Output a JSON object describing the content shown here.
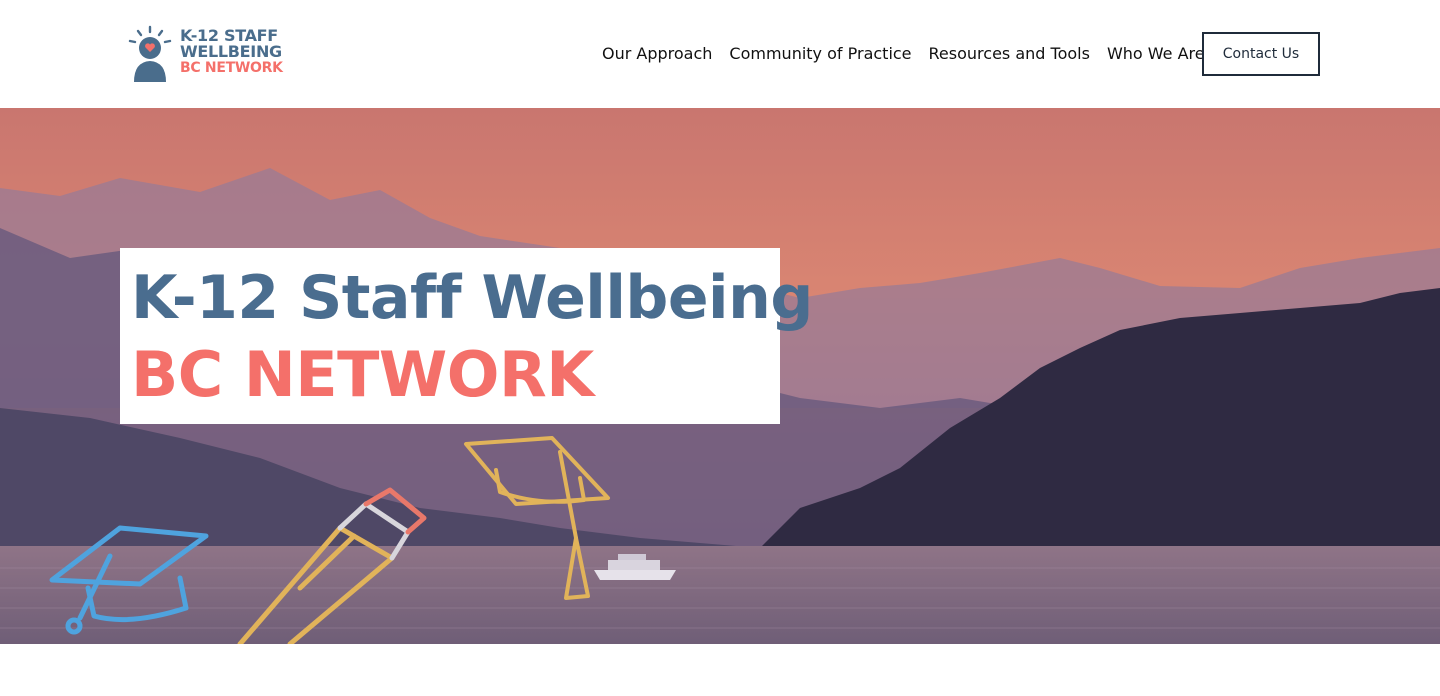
{
  "logo": {
    "line1": "K-12 STAFF",
    "line2": "WELLBEING",
    "line3": "BC NETWORK",
    "icon": "person-heart-icon"
  },
  "nav": {
    "items": [
      {
        "label": "Our Approach"
      },
      {
        "label": "Community of Practice"
      },
      {
        "label": "Resources and Tools"
      },
      {
        "label": "Who We Are"
      }
    ],
    "contact_label": "Contact Us"
  },
  "hero": {
    "title_line1": "K-12 Staff Wellbeing",
    "title_line2": "BC NETWORK",
    "doodles": [
      "graduation-cap-icon",
      "pencil-icon",
      "graduation-cap-icon"
    ]
  },
  "colors": {
    "brand_blue": "#4a6d8f",
    "brand_coral": "#f4706a",
    "button_border": "#1f2b3a"
  }
}
